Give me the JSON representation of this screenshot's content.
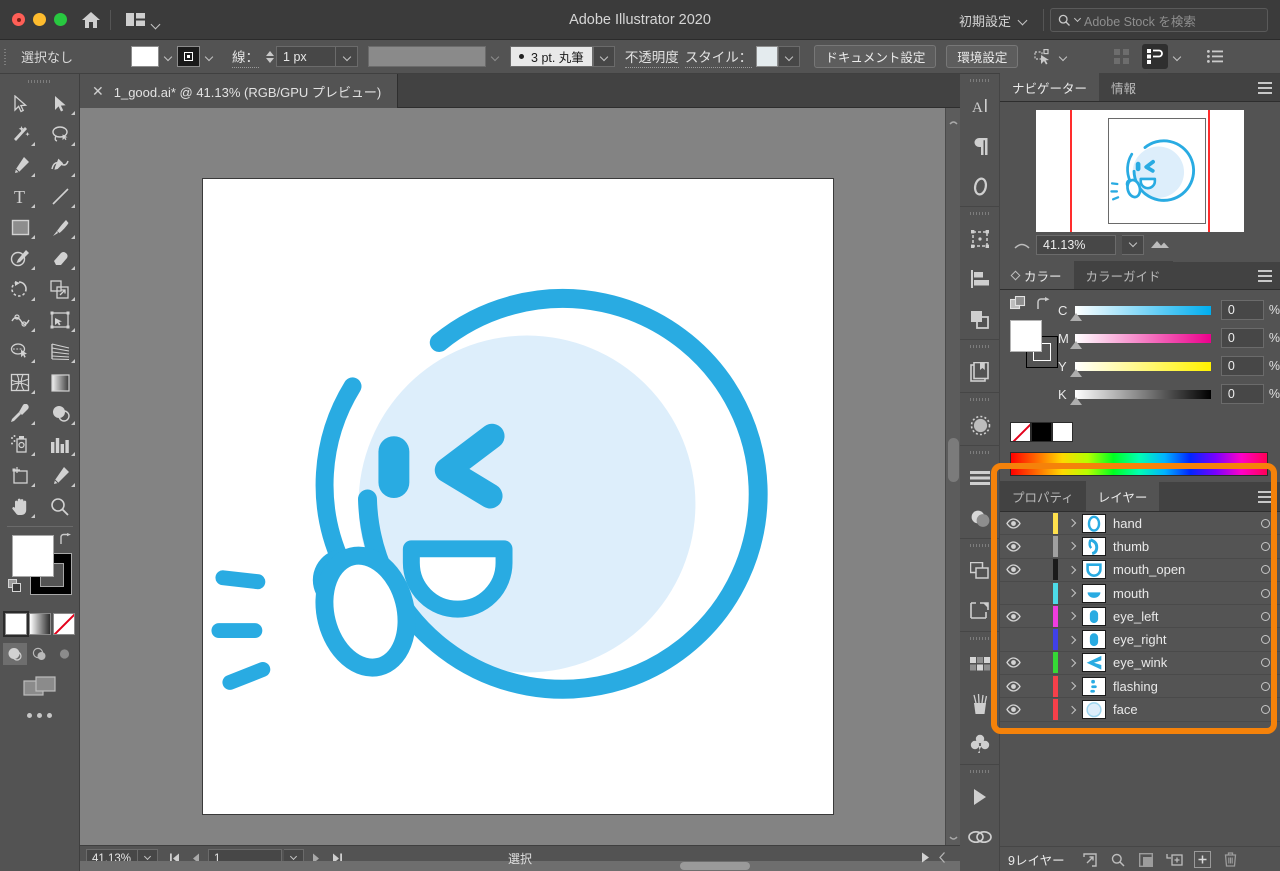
{
  "window": {
    "title": "Adobe Illustrator 2020",
    "traffic_lights": [
      "close",
      "minimize",
      "maximize"
    ],
    "home_icon": "home-icon",
    "arrange_icon": "arrange-documents-icon",
    "workspace": {
      "label": "初期設定",
      "chevron": "chevron-down-icon"
    },
    "search": {
      "icon": "search-icon",
      "placeholder": "Adobe Stock を検索"
    }
  },
  "control_bar": {
    "selection_status": "選択なし",
    "fill_swatch": {
      "name": "fill-swatch",
      "color": "#ffffff"
    },
    "stroke_swatch": {
      "name": "stroke-swatch",
      "color": "#1a1a1a"
    },
    "stroke_label": "線：",
    "stroke_weight": "1 px",
    "stroke_profile_placeholder": "",
    "brush_label": "3 pt. 丸筆",
    "opacity_label": "不透明度",
    "style_label": "スタイル：",
    "style_swatch_color": "#e4ebee",
    "document_setup_button": "ドキュメント設定",
    "preferences_button": "環境設定",
    "select_similar_icon": "select-similar-objects-icon",
    "align_icon": "align-icon",
    "arrange_icon": "arrange-objects-icon",
    "options_icon": "more-options-icon"
  },
  "toolbar": {
    "tools": [
      {
        "name": "selection-tool",
        "glyph": "arrow-outline"
      },
      {
        "name": "direct-selection-tool",
        "glyph": "arrow-solid"
      },
      {
        "name": "magic-wand-tool",
        "glyph": "wand"
      },
      {
        "name": "lasso-tool",
        "glyph": "lasso"
      },
      {
        "name": "pen-tool",
        "glyph": "pen"
      },
      {
        "name": "curvature-tool",
        "glyph": "curvature"
      },
      {
        "name": "type-tool",
        "glyph": "type-T"
      },
      {
        "name": "line-segment-tool",
        "glyph": "line"
      },
      {
        "name": "rectangle-tool",
        "glyph": "rectangle"
      },
      {
        "name": "paintbrush-tool",
        "glyph": "brush"
      },
      {
        "name": "shaper-tool",
        "glyph": "shaper"
      },
      {
        "name": "eraser-tool",
        "glyph": "eraser"
      },
      {
        "name": "rotate-tool",
        "glyph": "rotate"
      },
      {
        "name": "scale-tool",
        "glyph": "scale"
      },
      {
        "name": "width-tool",
        "glyph": "width"
      },
      {
        "name": "free-transform-tool",
        "glyph": "free-transform"
      },
      {
        "name": "shape-builder-tool",
        "glyph": "shape-builder"
      },
      {
        "name": "perspective-grid-tool",
        "glyph": "perspective"
      },
      {
        "name": "mesh-tool",
        "glyph": "mesh"
      },
      {
        "name": "gradient-tool",
        "glyph": "gradient"
      },
      {
        "name": "eyedropper-tool",
        "glyph": "eyedropper"
      },
      {
        "name": "blend-tool",
        "glyph": "blend"
      },
      {
        "name": "symbol-sprayer-tool",
        "glyph": "symbol-sprayer"
      },
      {
        "name": "column-graph-tool",
        "glyph": "bar-graph"
      },
      {
        "name": "artboard-tool",
        "glyph": "artboard"
      },
      {
        "name": "slice-tool",
        "glyph": "slice"
      },
      {
        "name": "hand-tool",
        "glyph": "hand"
      },
      {
        "name": "zoom-tool",
        "glyph": "magnifier"
      }
    ],
    "fill_color": "#ffffff",
    "stroke_color": "#000000",
    "color_modes": [
      "color-mode",
      "gradient-mode",
      "none-mode"
    ],
    "draw_modes": [
      "draw-normal",
      "draw-behind",
      "draw-inside"
    ],
    "screen_mode_icon": "screen-mode-icon",
    "more_tools_icon": "edit-toolbar-ellipsis"
  },
  "document_tab": {
    "close_icon": "close-icon",
    "title": "1_good.ai* @ 41.13% (RGB/GPU プレビュー)"
  },
  "artwork": {
    "description": "winking smiley face with raised hand",
    "face_fill": "#ddeefb",
    "line_color": "#29abe2",
    "background": "#ffffff"
  },
  "status_bar": {
    "zoom": "41.13%",
    "zoom_chevron": "chevron-down-icon",
    "first_page_icon": "first-artboard-icon",
    "prev_page_icon": "prev-artboard-icon",
    "page_number": "1",
    "page_chevron": "chevron-down-icon",
    "next_page_icon": "next-artboard-icon",
    "last_page_icon": "last-artboard-icon",
    "tool_status": "選択",
    "play_icon": "play-icon",
    "back_icon": "back-chevron-icon"
  },
  "dock_icons": [
    {
      "name": "character-panel-icon",
      "glyph": "A"
    },
    {
      "name": "paragraph-panel-icon",
      "glyph": "pilcrow"
    },
    {
      "name": "opentype-panel-icon",
      "glyph": "O"
    },
    {
      "name": "transform-panel-icon",
      "glyph": "transform"
    },
    {
      "name": "align-panel-icon",
      "glyph": "align"
    },
    {
      "name": "pathfinder-panel-icon",
      "glyph": "pathfinder"
    },
    {
      "name": "libraries-panel-icon",
      "glyph": "libraries"
    },
    {
      "name": "image-trace-panel-icon",
      "glyph": "image-trace"
    },
    {
      "name": "stroke-panel-icon",
      "glyph": "stroke-lines"
    },
    {
      "name": "transparency-panel-icon",
      "glyph": "transparency"
    },
    {
      "name": "layers-panel-icon",
      "glyph": "layers"
    },
    {
      "name": "artboards-panel-icon",
      "glyph": "artboards"
    },
    {
      "name": "swatches-panel-icon",
      "glyph": "swatches"
    },
    {
      "name": "brushes-panel-icon",
      "glyph": "brushes"
    },
    {
      "name": "symbols-panel-icon",
      "glyph": "symbols"
    },
    {
      "name": "actions-panel-icon",
      "glyph": "play"
    },
    {
      "name": "links-panel-icon",
      "glyph": "links"
    }
  ],
  "navigator_panel": {
    "tabs": [
      {
        "label": "ナビゲーター",
        "active": true
      },
      {
        "label": "情報",
        "active": false
      }
    ],
    "menu_icon": "panel-menu-icon",
    "zoom_value": "41.13%",
    "zoom_out_icon": "zoom-out-icon",
    "zoom_in_icon": "zoom-in-icon",
    "zoom_chevron": "chevron-down-icon",
    "guide_color": "#ff2d2d"
  },
  "color_panel": {
    "tabs": [
      {
        "label": "カラー",
        "active": true
      },
      {
        "label": "カラーガイド",
        "active": false
      }
    ],
    "menu_icon": "panel-menu-icon",
    "fill_color": "#ffffff",
    "stroke_color": "none",
    "channels": [
      {
        "label": "C",
        "value": "0",
        "unit": "%",
        "end_color": "#00aeef"
      },
      {
        "label": "M",
        "value": "0",
        "unit": "%",
        "end_color": "#ec008c"
      },
      {
        "label": "Y",
        "value": "0",
        "unit": "%",
        "end_color": "#fff200"
      },
      {
        "label": "K",
        "value": "0",
        "unit": "%",
        "end_color": "#000000"
      }
    ],
    "quick_swatches": [
      "none",
      "#000000",
      "#ffffff"
    ]
  },
  "layers_panel": {
    "tabs": [
      {
        "label": "プロパティ",
        "active": false
      },
      {
        "label": "レイヤー",
        "active": true
      }
    ],
    "menu_icon": "panel-menu-icon",
    "highlight_color": "#f5820a",
    "layers": [
      {
        "name": "hand",
        "visible": true,
        "color": "#ffe14d",
        "thumb": "hand-thumb"
      },
      {
        "name": "thumb",
        "visible": true,
        "color": "#a0a0a0",
        "thumb": "thumb-thumb"
      },
      {
        "name": "mouth_open",
        "visible": true,
        "color": "#1a1a1a",
        "thumb": "mouth-open-thumb"
      },
      {
        "name": "mouth",
        "visible": false,
        "color": "#4ddbe8",
        "thumb": "mouth-thumb"
      },
      {
        "name": "eye_left",
        "visible": true,
        "color": "#f03ce0",
        "thumb": "eye-left-thumb"
      },
      {
        "name": "eye_right",
        "visible": false,
        "color": "#4040e8",
        "thumb": "eye-right-thumb"
      },
      {
        "name": "eye_wink",
        "visible": true,
        "color": "#35d935",
        "thumb": "eye-wink-thumb"
      },
      {
        "name": "flashing",
        "visible": true,
        "color": "#f5404a",
        "thumb": "flashing-thumb"
      },
      {
        "name": "face",
        "visible": true,
        "color": "#f5404a",
        "thumb": "face-thumb"
      }
    ],
    "footer": {
      "count_label": "9レイヤー",
      "locate_icon": "locate-object-icon",
      "find_icon": "search-icon",
      "mask_icon": "make-clipping-mask-icon",
      "new_sublayer_icon": "new-sublayer-icon",
      "new_layer_icon": "new-layer-icon",
      "delete_icon": "delete-layer-icon"
    }
  }
}
